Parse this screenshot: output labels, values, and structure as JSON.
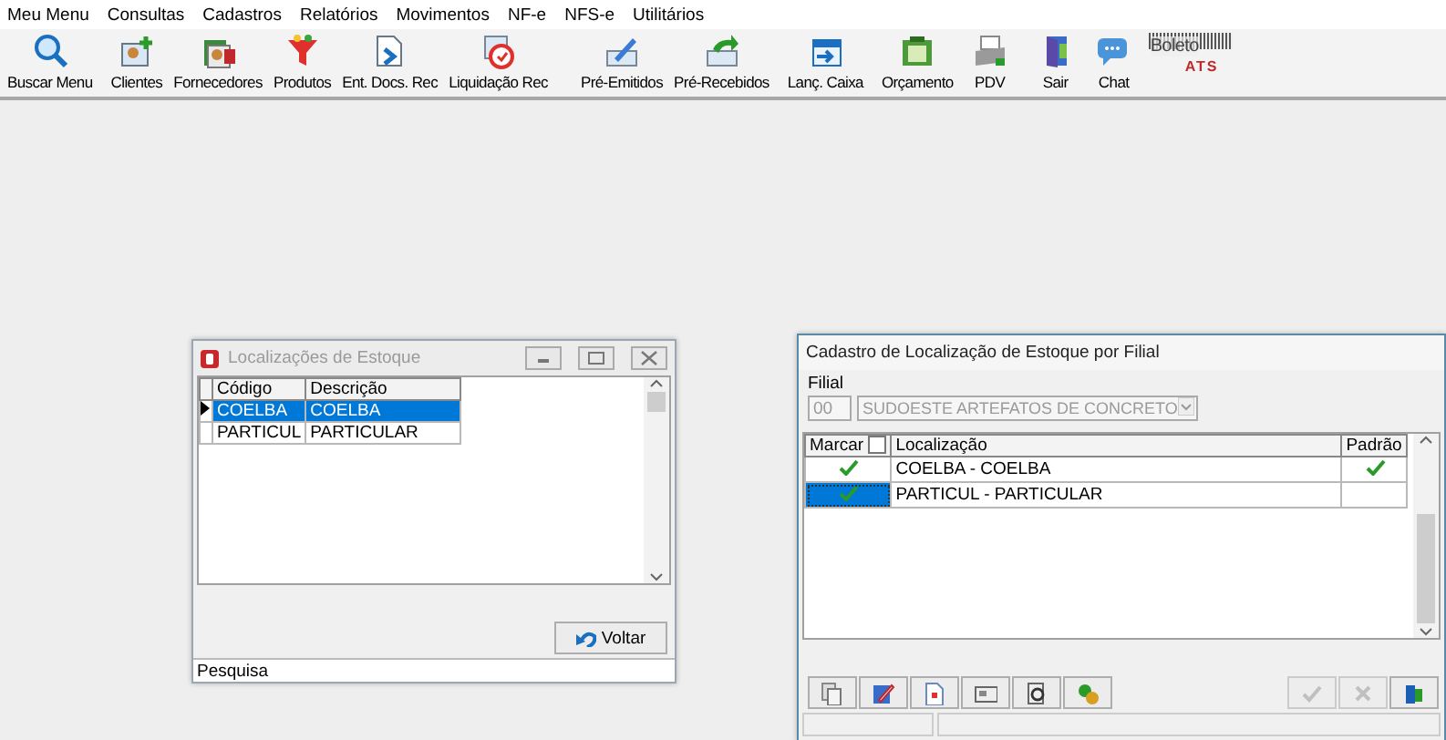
{
  "menu": [
    "Meu Menu",
    "Consultas",
    "Cadastros",
    "Relatórios",
    "Movimentos",
    "NF-e",
    "NFS-e",
    "Utilitários"
  ],
  "toolbar": {
    "items": [
      "Buscar Menu",
      "Clientes",
      "Fornecedores",
      "Produtos",
      "Ent. Docs. Rec",
      "Liquidação Rec",
      "Pré-Emitidos",
      "Pré-Recebidos",
      "Lanç. Caixa",
      "Orçamento",
      "PDV",
      "Sair",
      "Chat"
    ],
    "logo": {
      "text": "Boleto",
      "mark": "ATS"
    }
  },
  "windows": [
    {
      "kind": "lookup",
      "title": "Localizações de Estoque",
      "active": false,
      "columns": [
        "Código",
        "Descrição"
      ],
      "rows": [
        {
          "cells": [
            "COELBA",
            "COELBA"
          ],
          "selected": true
        },
        {
          "cells": [
            "PARTICUL",
            "PARTICULAR"
          ],
          "selected": false
        }
      ],
      "button": "Voltar",
      "status": "Pesquisa"
    },
    {
      "kind": "form",
      "title": "Cadastro de Localização de Estoque por Filial",
      "active": true,
      "filial": {
        "label": "Filial",
        "code": "00",
        "value": "SUDOESTE ARTEFATOS DE CONCRETO",
        "disabled": true
      },
      "columns": [
        {
          "label": "Marcar",
          "kind": "checkbox",
          "checked": false
        },
        {
          "label": "Localização",
          "kind": "text"
        },
        {
          "label": "Padrão",
          "kind": "text"
        }
      ],
      "rows": [
        {
          "marcar": true,
          "localizacao": "COELBA - COELBA",
          "padrao": true,
          "selected": false
        },
        {
          "marcar": true,
          "localizacao": "PARTICUL - PARTICULAR",
          "padrao": false,
          "selected": true
        }
      ],
      "actions": [
        {
          "disabled": false
        },
        {
          "disabled": false
        },
        {
          "disabled": false
        },
        {
          "disabled": false
        },
        {
          "disabled": false
        },
        {
          "disabled": false
        },
        {
          "disabled": true
        },
        {
          "disabled": true
        },
        {
          "disabled": false
        }
      ]
    }
  ]
}
